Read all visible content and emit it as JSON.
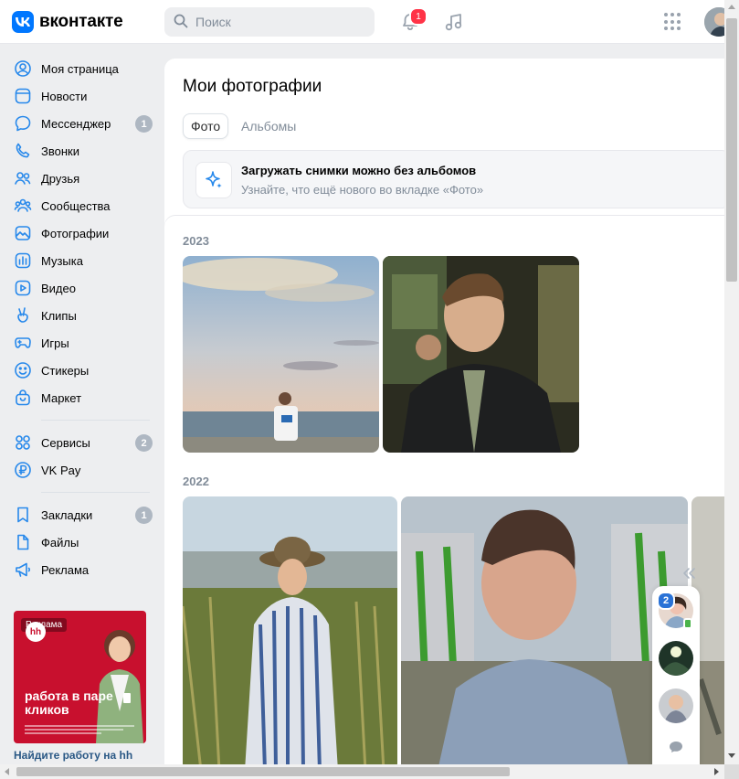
{
  "header": {
    "logo_text": "вконтакте",
    "search_placeholder": "Поиск",
    "notifications_count": "1"
  },
  "sidebar": {
    "items": [
      {
        "label": "Моя страница",
        "icon": "user-circle-icon"
      },
      {
        "label": "Новости",
        "icon": "newsfeed-icon"
      },
      {
        "label": "Мессенджер",
        "icon": "message-icon",
        "count": "1"
      },
      {
        "label": "Звонки",
        "icon": "phone-icon"
      },
      {
        "label": "Друзья",
        "icon": "users-icon"
      },
      {
        "label": "Сообщества",
        "icon": "communities-icon"
      },
      {
        "label": "Фотографии",
        "icon": "photo-icon"
      },
      {
        "label": "Музыка",
        "icon": "music-icon"
      },
      {
        "label": "Видео",
        "icon": "video-icon"
      },
      {
        "label": "Клипы",
        "icon": "clips-icon"
      },
      {
        "label": "Игры",
        "icon": "gamepad-icon"
      },
      {
        "label": "Стикеры",
        "icon": "smile-icon"
      },
      {
        "label": "Маркет",
        "icon": "market-icon"
      }
    ],
    "items2": [
      {
        "label": "Сервисы",
        "icon": "services-icon",
        "count": "2"
      },
      {
        "label": "VK Pay",
        "icon": "vkpay-icon"
      }
    ],
    "items3": [
      {
        "label": "Закладки",
        "icon": "bookmark-icon",
        "count": "1"
      },
      {
        "label": "Файлы",
        "icon": "file-icon"
      },
      {
        "label": "Реклама",
        "icon": "megaphone-icon"
      }
    ]
  },
  "ad": {
    "tag": "Реклама",
    "logo": "hh",
    "headline": "работа в паре кликов",
    "caption": "Найдите работу на hh"
  },
  "main": {
    "title": "Мои фотографии",
    "tabs": [
      "Фото",
      "Альбомы"
    ],
    "banner": {
      "title": "Загружать снимки можно без альбомов",
      "subtitle": "Узнайте, что ещё нового во вкладке «Фото»"
    },
    "years": [
      "2023",
      "2022"
    ]
  },
  "chat_widget": {
    "unread": "2"
  },
  "colors": {
    "accent": "#0077ff",
    "badge_red": "#ff3347",
    "counter_gray": "#aeb7c2",
    "link": "#2a5885"
  }
}
